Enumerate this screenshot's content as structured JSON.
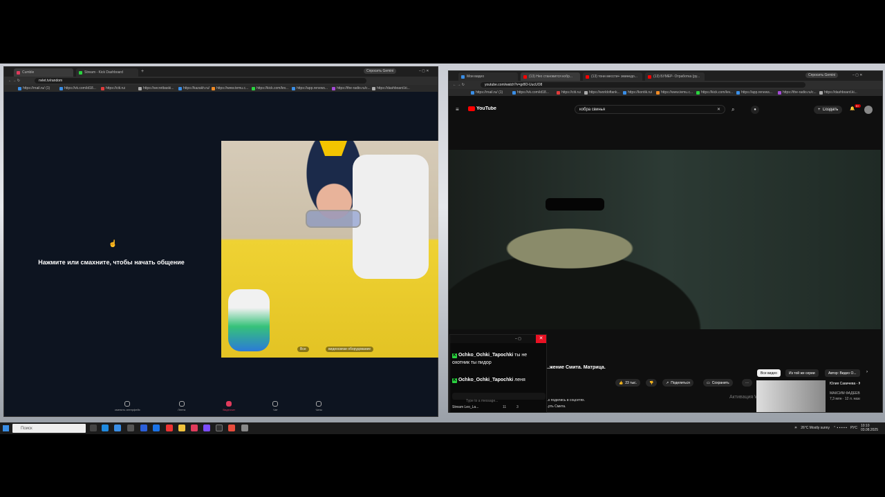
{
  "left_window": {
    "tabs": [
      {
        "label": "Cumble",
        "color": "#e03b5c",
        "active": true
      },
      {
        "label": "Stream - Kick Dashboard",
        "color": "#2ad33f",
        "active": false
      }
    ],
    "gemini_label": "Спросить Gemini",
    "url": "nvlet.tv/random",
    "bookmarks": [
      "https://rnail.ru/ (1)",
      "https://vk.com/id18...",
      "https://citi.ru/",
      "https://secretbaski...",
      "https://kazakh.ru/",
      "https://www.temu.c...",
      "https://kick.com/lev...",
      "https://app.renews...",
      "https://the-radio.ru/c...",
      "https://dashboard.ki..."
    ],
    "prompt": "Нажмите или смахните, чтобы начать общение",
    "cam_pill_1": "Все",
    "cam_pill_2": "видеосвязи оборудование",
    "bottom_nav": [
      {
        "label": "сменить интерфейс",
        "active": false
      },
      {
        "label": "Лента",
        "active": false
      },
      {
        "label": "Видеочат",
        "active": true
      },
      {
        "label": "Чат",
        "active": false
      },
      {
        "label": "Чаты",
        "active": false
      }
    ]
  },
  "right_window": {
    "tabs": [
      {
        "label": "Мои видео",
        "color": "#3a8ee6"
      },
      {
        "label": "(13) Нео становится кобр...",
        "color": "#f00"
      },
      {
        "label": "(13) тони мессти+ эминедо...",
        "color": "#f00"
      },
      {
        "label": "(13) БУМЕР- Отработка (ру...",
        "color": "#f00"
      }
    ],
    "gemini_label": "Спросить Gemini",
    "url": "youtube.com/watch?v=gr8O-UucUO8",
    "bookmarks": [
      "https://rnail.ru/ (1)",
      "https://vk.com/id18...",
      "https://citi.ru/",
      "https://worldoftank...",
      "https://kontik.ru/",
      "https://www.temu.c...",
      "https://kick.com/lev...",
      "https://app.renews...",
      "https://the-radio.ru/c...",
      "https://dashboard.ki..."
    ],
    "youtube": {
      "logo": "YouTube",
      "search_query": "кобра  свинья",
      "create_label": "Создать",
      "notif_count": "9+",
      "video_title": "...жение Смита. Матрица.",
      "like_count": "23 тыс.",
      "share_label": "Поделиться",
      "save_label": "Сохранить",
      "chips": [
        {
          "label": "Все видео",
          "active": true
        },
        {
          "label": "Из той же серии",
          "active": false
        },
        {
          "label": "Автор: Видео О...",
          "active": false
        }
      ],
      "description_lines": [
        "...к поделись в соцсетях.",
        "...рть Смита."
      ],
      "reco": {
        "title": "Юлия Савичева - Юлия",
        "channel": "МАКСИМ ФАДЕЕВ",
        "meta": "7,3 млн · 12 л. назад"
      },
      "activation_text": "Активация Wi..."
    }
  },
  "chat": {
    "messages": [
      {
        "user": "Ochko_Ochki_Tapochki",
        "text": "ты не охотник ты пидор"
      },
      {
        "user": "Ochko_Ochki_Tapochki",
        "text": "леня"
      }
    ],
    "input_placeholder": "Type to a message...",
    "stream_label": "Stream Leo_La...",
    "stat_1": "11",
    "stat_2": "3"
  },
  "taskbar": {
    "search_placeholder": "Поиск",
    "weather": "26°C  Mostly sunny",
    "lang": "РУС",
    "time": "10:10",
    "date": "03.08.2025"
  }
}
